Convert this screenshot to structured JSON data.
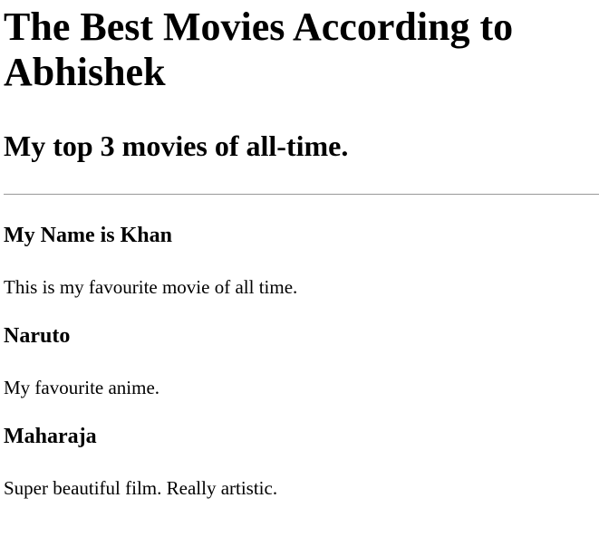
{
  "title": "The Best Movies According to Abhishek",
  "subtitle": "My top 3 movies of all-time.",
  "movies": [
    {
      "name": "My Name is Khan",
      "desc": "This is my favourite movie of all time."
    },
    {
      "name": "Naruto",
      "desc": "My favourite anime."
    },
    {
      "name": "Maharaja",
      "desc": "Super beautiful film. Really artistic."
    }
  ]
}
